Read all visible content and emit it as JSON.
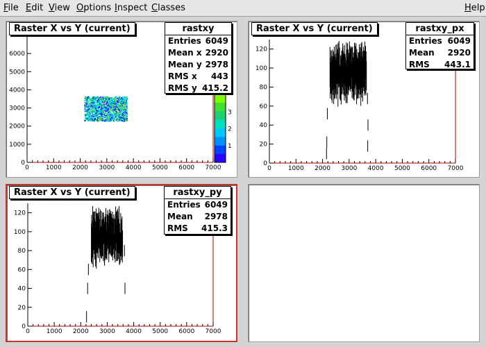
{
  "menu": [
    {
      "label": "File",
      "u": "F",
      "rest": "ile"
    },
    {
      "label": "Edit",
      "u": "E",
      "rest": "dit"
    },
    {
      "label": "View",
      "u": "V",
      "rest": "iew"
    },
    {
      "label": "Options",
      "u": "O",
      "rest": "ptions"
    },
    {
      "label": "Inspect",
      "u": "I",
      "rest": "nspect"
    },
    {
      "label": "Classes",
      "u": "C",
      "rest": "lasses"
    },
    {
      "label": "Help",
      "u": "H",
      "rest": "elp"
    }
  ],
  "pads": [
    {
      "title": "Raster X vs Y (current)",
      "stats_name": "rastxy",
      "stats": [
        {
          "label": "Entries",
          "value": "6049"
        },
        {
          "label": "Mean x",
          "value": "2920"
        },
        {
          "label": "Mean y",
          "value": "2978"
        },
        {
          "label": "RMS x",
          "value": "443"
        },
        {
          "label": "RMS y",
          "value": "415.2"
        }
      ],
      "xticks": [
        "0",
        "1000",
        "2000",
        "3000",
        "4000",
        "5000",
        "6000",
        "7000"
      ],
      "yticks": [
        "0",
        "1000",
        "2000",
        "3000",
        "4000",
        "5000",
        "6000"
      ],
      "zticks": [
        "1",
        "2",
        "3"
      ]
    },
    {
      "title": "Raster X vs Y (current)",
      "stats_name": "rastxy_px",
      "stats": [
        {
          "label": "Entries",
          "value": "6049"
        },
        {
          "label": "Mean",
          "value": "2920"
        },
        {
          "label": "RMS",
          "value": "443.1"
        }
      ],
      "xticks": [
        "0",
        "1000",
        "2000",
        "3000",
        "4000",
        "5000",
        "6000",
        "7000"
      ],
      "yticks": [
        "0",
        "20",
        "40",
        "60",
        "80",
        "100",
        "120"
      ]
    },
    {
      "title": "Raster X vs Y (current)",
      "stats_name": "rastxy_py",
      "stats": [
        {
          "label": "Entries",
          "value": "6049"
        },
        {
          "label": "Mean",
          "value": "2978"
        },
        {
          "label": "RMS",
          "value": "415.3"
        }
      ],
      "xticks": [
        "0",
        "1000",
        "2000",
        "3000",
        "4000",
        "5000",
        "6000",
        "7000"
      ],
      "yticks": [
        "0",
        "20",
        "40",
        "60",
        "80",
        "100",
        "120"
      ]
    }
  ],
  "colors": {
    "active_border": "#d03030",
    "hist_color": "#000000",
    "axis_line": "#b00000"
  }
}
